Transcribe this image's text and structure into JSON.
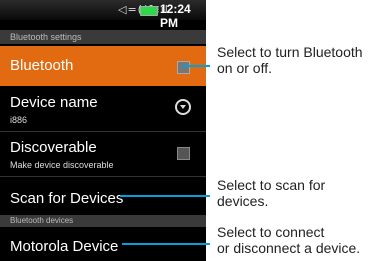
{
  "status": {
    "time": "12:24 PM",
    "icons": "◁=((1⁝ıl"
  },
  "headers": {
    "bluetooth": "Bluetooth settings",
    "devices": "Bluetooth devices"
  },
  "rows": {
    "bluetooth": {
      "title": "Bluetooth",
      "checked": false
    },
    "device_name": {
      "title": "Device name",
      "value": "i886"
    },
    "discoverable": {
      "title": "Discoverable",
      "sub": "Make device discoverable",
      "checked": false
    },
    "scan": {
      "title": "Scan for Devices"
    },
    "device": {
      "title": "Motorola Device"
    }
  },
  "callouts": {
    "c1": [
      "Select to turn Bluetooth",
      "on or off."
    ],
    "c2": [
      "Select to scan for",
      "devices."
    ],
    "c3": [
      "Select to connect",
      "or disconnect a device."
    ]
  },
  "colors": {
    "accent": "#e26a10",
    "leader": "#00a3d9"
  }
}
